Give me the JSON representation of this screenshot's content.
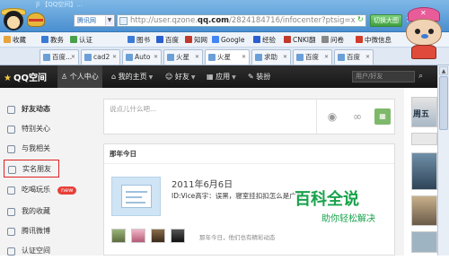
{
  "browser": {
    "window_title": "Jl 【QQ空间】...",
    "search_engine": "腾讯网",
    "address_prefix": "http://user.qzone.",
    "address_domain": "qq.com",
    "address_suffix": "/2824184716/infocenter?ptsig=x",
    "mode_button": "切换大图",
    "bookmarks": [
      {
        "label": "收藏",
        "color": "#e8a33a"
      },
      {
        "label": "教务",
        "color": "#3a7bd5"
      },
      {
        "label": "认证",
        "color": "#4aa04a"
      },
      {
        "label": "图书",
        "color": "#3a7bd5"
      },
      {
        "label": "百度",
        "color": "#2a5fd0"
      },
      {
        "label": "知网",
        "color": "#c0392b"
      },
      {
        "label": "Google",
        "color": "#4285f4"
      },
      {
        "label": "经验",
        "color": "#2a5fd0"
      },
      {
        "label": "CNKI翻",
        "color": "#c0392b"
      },
      {
        "label": "问卷",
        "color": "#888888"
      },
      {
        "label": "中微信息",
        "color": "#d23b2a"
      }
    ],
    "tabs": [
      {
        "label": "百度..."
      },
      {
        "label": "cad2"
      },
      {
        "label": "Auto"
      },
      {
        "label": "火星"
      },
      {
        "label": "火星"
      },
      {
        "label": "求助"
      },
      {
        "label": "百度"
      },
      {
        "label": "百度"
      }
    ]
  },
  "qzone_nav": {
    "logo": "QQ空间",
    "items": [
      {
        "label": "个人中心",
        "caret": ""
      },
      {
        "label": "我的主页",
        "caret": "▼"
      },
      {
        "label": "好友",
        "caret": "▼"
      },
      {
        "label": "应用",
        "caret": "▼"
      },
      {
        "label": "装扮",
        "caret": ""
      }
    ],
    "search_placeholder": "用户/好友"
  },
  "sidebar": {
    "items": [
      {
        "label": "好友动态",
        "icon": "feed-icon"
      },
      {
        "label": "特别关心",
        "icon": "heart-icon"
      },
      {
        "label": "与我相关",
        "icon": "bell-icon"
      },
      {
        "label": "实名朋友",
        "icon": "friends-icon"
      },
      {
        "label": "吃喝玩乐",
        "icon": "food-icon",
        "badge": "new"
      },
      {
        "label": "我的收藏",
        "icon": "star-icon"
      },
      {
        "label": "腾讯微博",
        "icon": "weibo-icon"
      },
      {
        "label": "认证空间",
        "icon": "verified-icon"
      }
    ]
  },
  "composer": {
    "placeholder": "说点儿什么吧..."
  },
  "memory_card": {
    "header": "那年今日",
    "date": "2011年6月6日",
    "text": "ID:Vice高宇：误黑，寝室挂扣扣怎么是广东",
    "friends_note": "那年今日，他们也有精彩动态"
  },
  "watermark": {
    "logo": "百科全说",
    "sub": "助你轻松解决"
  },
  "right_col": {
    "headline": "周五"
  }
}
